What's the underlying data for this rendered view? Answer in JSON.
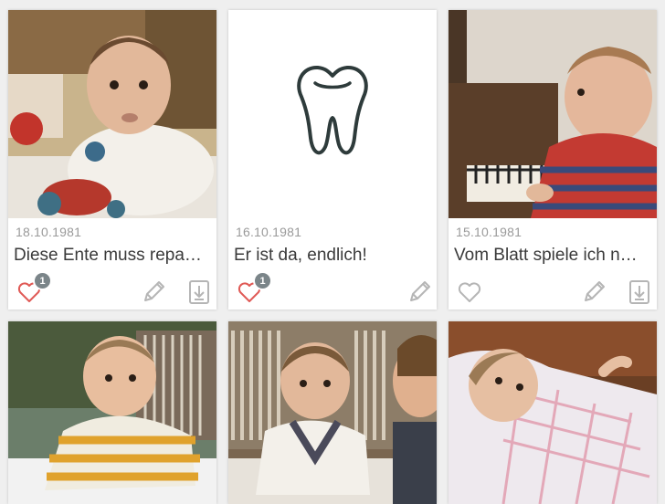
{
  "accent": "#e05a56",
  "icon_gray": "#b5b5b5",
  "cards": [
    {
      "date": "18.10.1981",
      "title": "Diese Ente muss repa…",
      "likes": "1",
      "icons": [
        "heart-icon",
        "pencil-icon",
        "download-icon"
      ]
    },
    {
      "date": "16.10.1981",
      "title": "Er ist da, endlich!",
      "likes": "1",
      "icons": [
        "heart-icon",
        "pencil-icon"
      ]
    },
    {
      "date": "15.10.1981",
      "title": "Vom Blatt spiele ich n…",
      "likes": "",
      "icons": [
        "heart-icon",
        "pencil-icon",
        "download-icon"
      ]
    }
  ]
}
